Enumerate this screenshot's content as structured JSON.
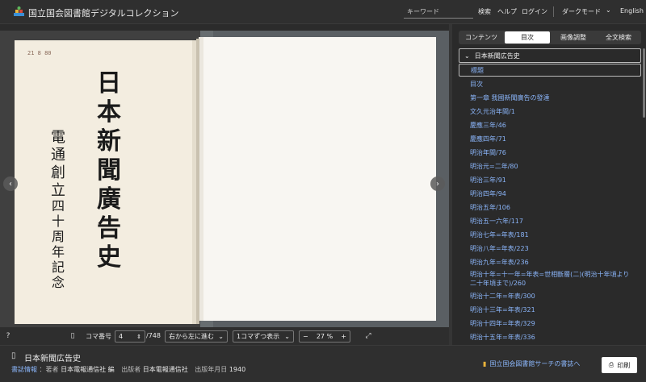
{
  "header": {
    "title": "国立国会図書館デジタルコレクション",
    "search_placeholder": "キーワード",
    "search_button": "検索",
    "help": "ヘルプ",
    "login": "ログイン",
    "dark_mode": "ダークモード",
    "language": "English"
  },
  "viewer": {
    "page_label": "コマ番号",
    "page_value": "4",
    "page_total": "/748",
    "direction": "右から左に進む",
    "display_mode": "1コマずつ表示",
    "zoom": "27",
    "zoom_unit": "%",
    "stamp": "21 8 80",
    "cover_title_chars": [
      "日",
      "本",
      "新",
      "聞",
      "廣",
      "告",
      "史"
    ],
    "cover_author_col1": [
      "電",
      "通",
      "創",
      "立"
    ],
    "cover_author_col2": [
      "四",
      "十",
      "周",
      "年",
      "記",
      "念"
    ]
  },
  "panel": {
    "tabs": [
      {
        "label": "コンテンツ",
        "active": false
      },
      {
        "label": "目次",
        "active": true
      },
      {
        "label": "画像調整",
        "active": false
      },
      {
        "label": "全文検索",
        "active": false
      }
    ],
    "toc_header": "日本新聞広告史",
    "toc_selected": "標題",
    "toc_items": [
      "目次",
      "第一章 我國新聞廣告の發達",
      "文久元治年間/1",
      "慶應三年/46",
      "慶應四年/71",
      "明治年間/76",
      "明治元=二年/80",
      "明治三年/91",
      "明治四年/94",
      "明治五年/106",
      "明治五一六年/117",
      "明治七年=年表/181",
      "明治八年=年表/223",
      "明治九年=年表/236",
      "明治十年=十一年=年表=世相斷層(二)(明治十年頃より二十年頃まで)/260",
      "明治十二年=年表/300",
      "明治十三年=年表/321",
      "明治十四年=年表/329",
      "明治十五年=年表/336"
    ]
  },
  "footer": {
    "title": "日本新聞広告史",
    "info_label": "書誌情報",
    "author_key": "：著者",
    "author": "日本電報通信社 編",
    "publisher_key": "出版者",
    "publisher": "日本電報通信社",
    "date_key": "出版年月日",
    "date": "1940",
    "ndl_search": "国立国会図書館サーチの書誌へ",
    "print": "印刷"
  },
  "colors": {
    "link": "#8ab4f8",
    "background": "#2b2b2b",
    "paper": "#f3ede0"
  }
}
